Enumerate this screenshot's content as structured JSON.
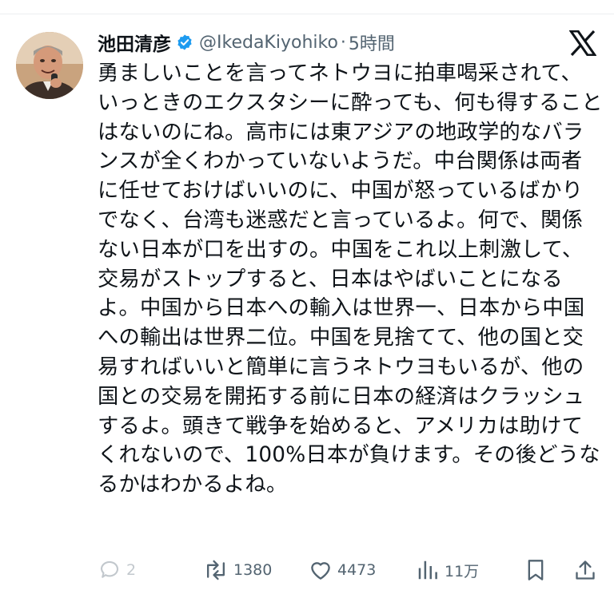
{
  "author": {
    "display_name": "池田清彦",
    "handle": "@IkedaKiyohiko",
    "separator": "·",
    "time": "5時間",
    "verified_color": "#1d9bf0"
  },
  "post": {
    "text": "勇ましいことを言ってネトウヨに拍車喝采されて、いっときのエクスタシーに酔っても、何も得することはないのにね。高市には東アジアの地政学的なバランスが全くわかっていないようだ。中台関係は両者に任せておけばいいのに、中国が怒っているばかりでなく、台湾も迷惑だと言っているよ。何で、関係ない日本が口を出すの。中国をこれ以上刺激して、交易がストップすると、日本はやばいことになるよ。中国から日本への輸入は世界一、日本から中国への輸出は世界二位。中国を見捨てて、他の国と交易すればいいと簡単に言うネトウヨもいるが、他の国との交易を開拓する前に日本の経済はクラッシュするよ。頭きて戦争を始めると、アメリカは助けてくれないので、100%日本が負けます。その後どうなるかはわかるよね。"
  },
  "actions": {
    "reply_count": "2",
    "retweet_count": "1380",
    "like_count": "4473",
    "views_count": "11万"
  },
  "icons": {
    "brand": "x-logo-icon",
    "reply": "reply-icon",
    "retweet": "retweet-icon",
    "like": "heart-icon",
    "views": "views-chart-icon",
    "bookmark": "bookmark-icon",
    "share": "share-icon"
  }
}
